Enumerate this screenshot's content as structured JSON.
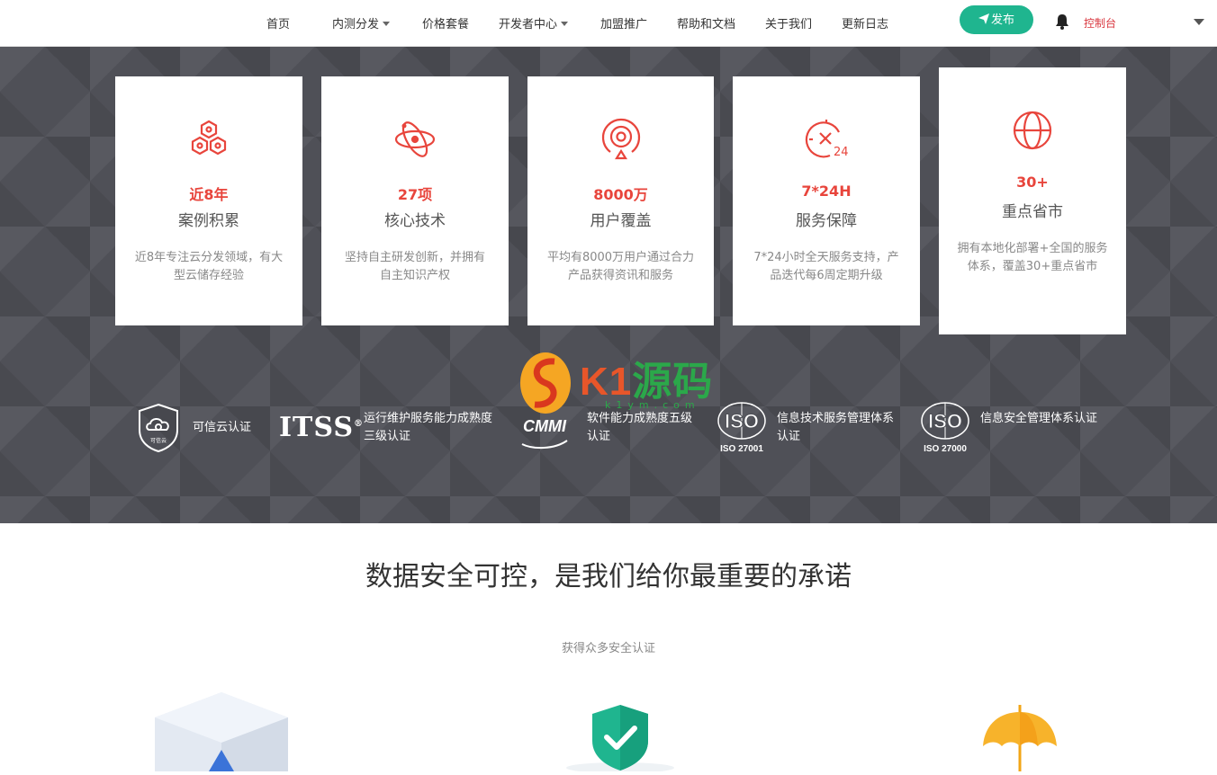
{
  "nav": {
    "items": [
      {
        "label": "首页",
        "dropdown": false
      },
      {
        "label": "内测分发",
        "dropdown": true
      },
      {
        "label": "价格套餐",
        "dropdown": false
      },
      {
        "label": "开发者中心",
        "dropdown": true
      },
      {
        "label": "加盟推广",
        "dropdown": false
      },
      {
        "label": "帮助和文档",
        "dropdown": false
      },
      {
        "label": "关于我们",
        "dropdown": false
      },
      {
        "label": "更新日志",
        "dropdown": false
      }
    ],
    "publish_label": "发布",
    "console_label": "控制台",
    "icons": [
      "send-icon",
      "bell-icon",
      "caret-down-icon"
    ]
  },
  "colors": {
    "accent_red": "#e8453c",
    "publish_green": "#1fb58f",
    "hero_bg": "#4f5057"
  },
  "stats": [
    {
      "icon": "cubes-icon",
      "value": "近8年",
      "label": "案例积累",
      "desc": "近8年专注云分发领域，有大型云储存经验"
    },
    {
      "icon": "atom-icon",
      "value": "27项",
      "label": "核心技术",
      "desc": "坚持自主研发创新，并拥有自主知识产权"
    },
    {
      "icon": "location-target-icon",
      "value": "8000万",
      "label": "用户覆盖",
      "desc": "平均有8000万用户通过合力产品获得资讯和服务"
    },
    {
      "icon": "clock-24-icon",
      "value": "7*24H",
      "label": "服务保障",
      "desc": "7*24小时全天服务支持，产品迭代每6周定期升级"
    },
    {
      "icon": "globe-icon",
      "value": "30+",
      "label": "重点省市",
      "desc": "拥有本地化部署+全国的服务体系，覆盖30+重点省市"
    }
  ],
  "certs": [
    {
      "logo": "trusted-cloud-badge",
      "logo_text": "可信云",
      "label": "可信云认证"
    },
    {
      "logo": "itss-logo",
      "logo_text": "ITSS",
      "label": "运行维护服务能力成熟度三级认证"
    },
    {
      "logo": "cmmi-logo",
      "logo_text": "CMMI",
      "label": "软件能力成熟度五级认证"
    },
    {
      "logo": "iso-27001-logo",
      "logo_text": "ISO",
      "logo_sub": "ISO 27001",
      "label": "信息技术服务管理体系认证"
    },
    {
      "logo": "iso-27000-logo",
      "logo_text": "ISO",
      "logo_sub": "ISO 27000",
      "label": "信息安全管理体系认证"
    }
  ],
  "watermark": {
    "main_a": "K1",
    "main_b": "源码",
    "sub": "k1ym.com"
  },
  "security": {
    "title": "数据安全可控，是我们给你最重要的承诺",
    "subtitle": "获得众多安全认证",
    "features": [
      "cube-shield-icon",
      "shield-check-icon",
      "umbrella-icon"
    ]
  }
}
